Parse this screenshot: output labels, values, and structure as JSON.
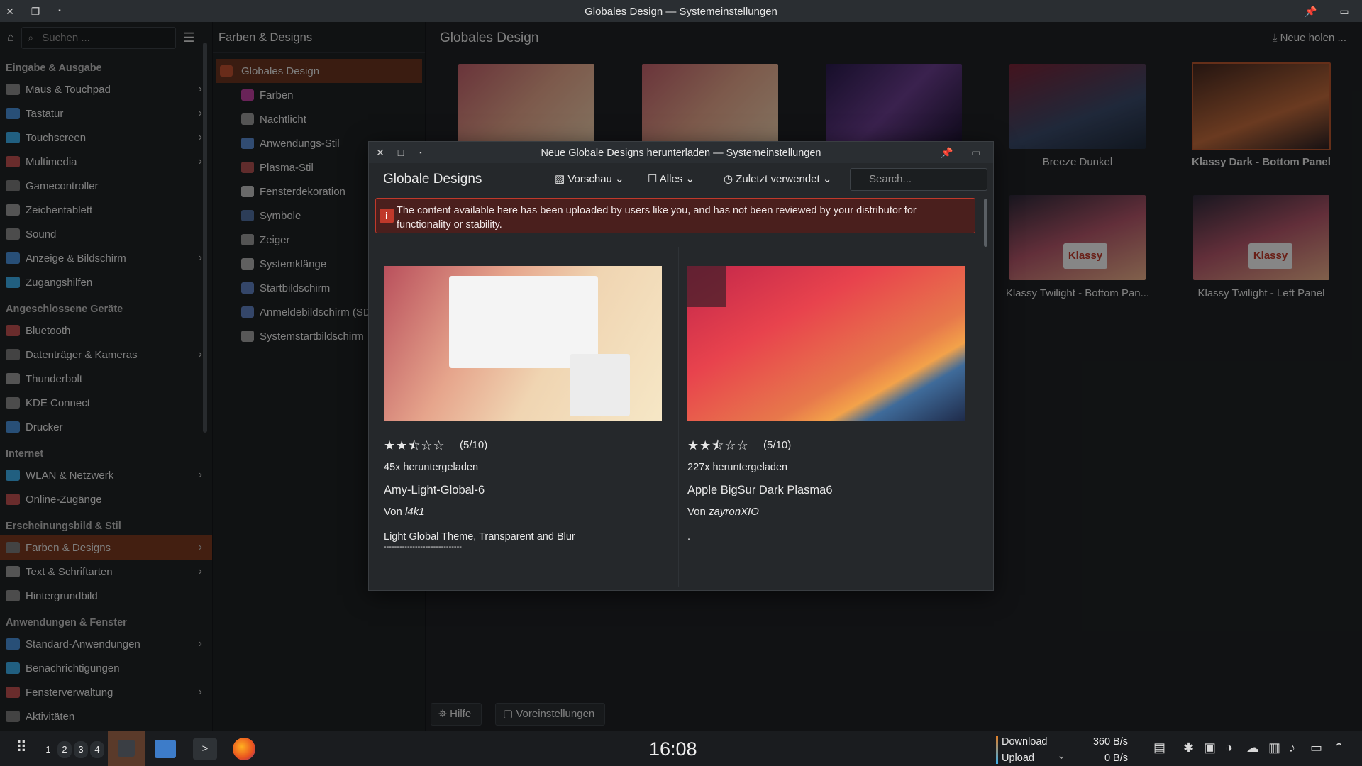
{
  "window": {
    "title": "Globales Design — Systemeinstellungen"
  },
  "sidebar": {
    "search_placeholder": "Suchen ...",
    "groups": [
      {
        "label": "Eingabe & Ausgabe",
        "items": [
          {
            "label": "Maus & Touchpad",
            "chev": true
          },
          {
            "label": "Tastatur",
            "chev": true
          },
          {
            "label": "Touchscreen",
            "chev": true
          },
          {
            "label": "Multimedia",
            "chev": true
          },
          {
            "label": "Gamecontroller",
            "chev": false
          },
          {
            "label": "Zeichentablett",
            "chev": false
          },
          {
            "label": "Sound",
            "chev": false
          },
          {
            "label": "Anzeige & Bildschirm",
            "chev": true
          },
          {
            "label": "Zugangshilfen",
            "chev": false
          }
        ]
      },
      {
        "label": "Angeschlossene Geräte",
        "items": [
          {
            "label": "Bluetooth",
            "chev": false
          },
          {
            "label": "Datenträger & Kameras",
            "chev": true
          },
          {
            "label": "Thunderbolt",
            "chev": false
          },
          {
            "label": "KDE Connect",
            "chev": false
          },
          {
            "label": "Drucker",
            "chev": false
          }
        ]
      },
      {
        "label": "Internet",
        "items": [
          {
            "label": "WLAN & Netzwerk",
            "chev": true
          },
          {
            "label": "Online-Zugänge",
            "chev": false
          }
        ]
      },
      {
        "label": "Erscheinungsbild & Stil",
        "items": [
          {
            "label": "Farben & Designs",
            "chev": true,
            "selected": true
          },
          {
            "label": "Text & Schriftarten",
            "chev": true
          },
          {
            "label": "Hintergrundbild",
            "chev": false
          }
        ]
      },
      {
        "label": "Anwendungen & Fenster",
        "items": [
          {
            "label": "Standard-Anwendungen",
            "chev": true
          },
          {
            "label": "Benachrichtigungen",
            "chev": false
          },
          {
            "label": "Fensterverwaltung",
            "chev": true
          },
          {
            "label": "Aktivitäten",
            "chev": false
          }
        ]
      }
    ]
  },
  "middle": {
    "title": "Farben & Designs",
    "items": [
      "Globales Design",
      "Farben",
      "Nachtlicht",
      "Anwendungs-Stil",
      "Plasma-Stil",
      "Fensterdekoration",
      "Symbole",
      "Zeiger",
      "Systemklänge",
      "Startbildschirm",
      "Anmeldebildschirm (SD",
      "Systemstartbildschirm"
    ]
  },
  "content": {
    "title": "Globales Design",
    "get_new": "Neue holen ...",
    "themes": [
      "Breeze Dunkel",
      "Klassy Dark - Bottom Panel",
      "Klassy Twilight - Bottom Pan...",
      "Klassy Twilight - Left Panel"
    ],
    "thumb_logo": "Klassy",
    "help": "Hilfe",
    "defaults": "Voreinstellungen"
  },
  "dialog": {
    "title": "Neue Globale Designs herunterladen — Systemeinstellungen",
    "heading": "Globale Designs",
    "view": "Vorschau",
    "filter": "Alles",
    "sort": "Zuletzt verwendet",
    "search_placeholder": "Search...",
    "warning": "The content available here has been uploaded by users like you, and has not been reviewed by your distributor for functionality or stability.",
    "cards": [
      {
        "rating": "(5/10)",
        "rating_value": 5,
        "downloads": "45x heruntergeladen",
        "name": "Amy-Light-Global-6",
        "by_prefix": "Von ",
        "author": "l4k1",
        "desc": "Light Global Theme, Transparent and Blur",
        "desc2": "------------------------------"
      },
      {
        "rating": "(5/10)",
        "rating_value": 5,
        "downloads": "227x heruntergeladen",
        "name": "Apple BigSur Dark Plasma6",
        "by_prefix": "Von ",
        "author": "zayronXIO",
        "desc": ".",
        "desc2": ""
      }
    ]
  },
  "taskbar": {
    "desktops": [
      "1",
      "2",
      "3",
      "4"
    ],
    "clock": "16:08",
    "download_label": "Download",
    "upload_label": "Upload",
    "download_rate": "360 B/s",
    "upload_rate": "0 B/s"
  },
  "colors": {
    "accent": "#7a3a1f",
    "warning_border": "#c0392b",
    "background": "#1b1e20"
  }
}
